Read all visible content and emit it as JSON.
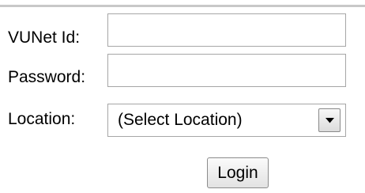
{
  "form": {
    "vunet_id": {
      "label": "VUNet Id:",
      "value": ""
    },
    "password": {
      "label": "Password:",
      "value": ""
    },
    "location": {
      "label": "Location:",
      "selected": "(Select Location)",
      "arrow_icon": "chevron-down-icon"
    },
    "login_label": "Login"
  }
}
